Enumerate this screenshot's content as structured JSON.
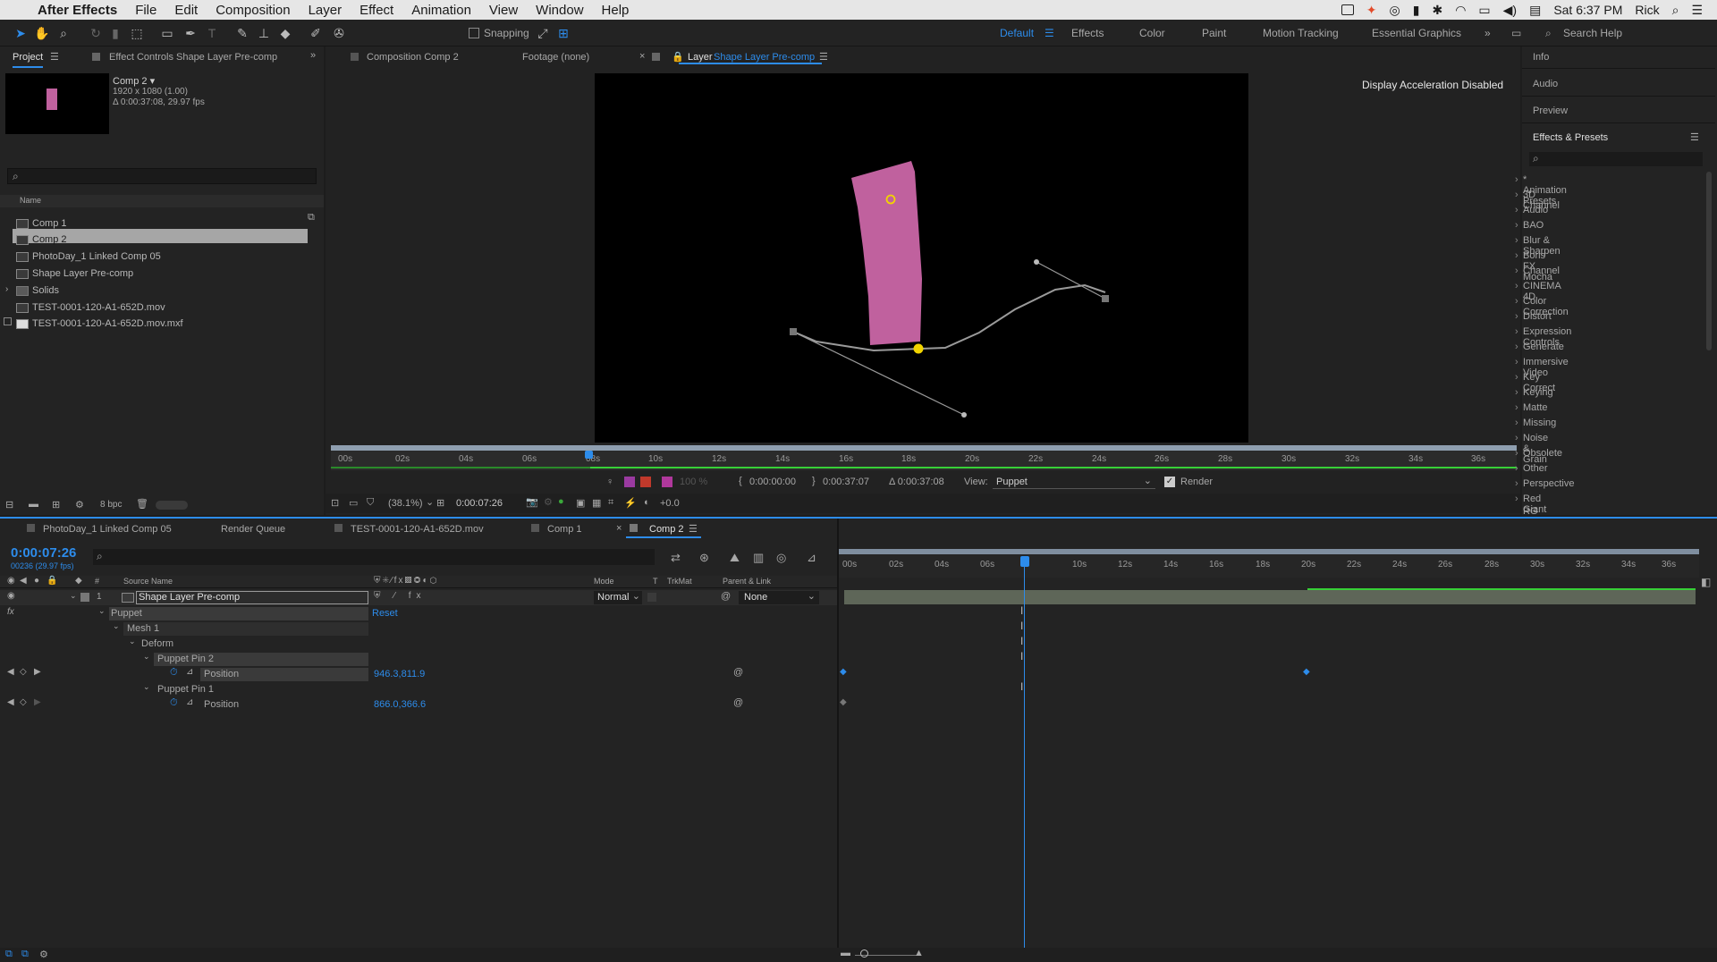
{
  "menubar": {
    "app_name": "After Effects",
    "items": [
      "File",
      "Edit",
      "Composition",
      "Layer",
      "Effect",
      "Animation",
      "View",
      "Window",
      "Help"
    ],
    "clock": "Sat 6:37 PM",
    "user": "Rick"
  },
  "toolbar": {
    "snapping_label": "Snapping",
    "workspaces": [
      "Default",
      "Effects",
      "Color",
      "Paint",
      "Motion Tracking",
      "Essential Graphics"
    ],
    "search_help": "Search Help"
  },
  "project": {
    "tab_label": "Project",
    "effect_controls_tab": "Effect Controls Shape Layer Pre-comp",
    "comp_name": "Comp 2 ▾",
    "comp_size": "1920 x 1080 (1.00)",
    "comp_duration": "Δ 0:00:37:08, 29.97 fps",
    "search_placeholder": "",
    "column_name": "Name",
    "items": [
      "Comp 1",
      "Comp 2",
      "PhotoDay_1 Linked Comp 05",
      "Shape Layer Pre-comp",
      "Solids",
      "TEST-0001-120-A1-652D.mov",
      "TEST-0001-120-A1-652D.mov.mxf"
    ],
    "bpc": "8 bpc"
  },
  "viewer": {
    "tab_composition": "Composition Comp 2",
    "tab_footage": "Footage (none)",
    "tab_layer_prefix": "Layer",
    "tab_layer_name": "Shape Layer Pre-comp",
    "notice": "Display Acceleration Disabled",
    "ruler_labels": [
      "00s",
      "02s",
      "04s",
      "06s",
      "08s",
      "10s",
      "12s",
      "14s",
      "16s",
      "18s",
      "20s",
      "22s",
      "24s",
      "26s",
      "28s",
      "30s",
      "32s",
      "34s",
      "36s"
    ],
    "opacity": "100 %",
    "in_time": "0:00:00:00",
    "out_time": "0:00:37:07",
    "duration": "Δ 0:00:37:08",
    "view_label": "View:",
    "view_value": "Puppet",
    "render_label": "Render",
    "zoom": "(38.1%)",
    "current_time": "0:00:07:26",
    "exposure": "+0.0",
    "shape_color": "#c0619e"
  },
  "right_panels": {
    "info": "Info",
    "audio": "Audio",
    "preview": "Preview",
    "effects_presets": "Effects & Presets",
    "effects": [
      "* Animation Presets",
      "3D Channel",
      "Audio",
      "BAO",
      "Blur & Sharpen",
      "Boris FX Mocha",
      "Channel",
      "CINEMA 4D",
      "Color Correction",
      "Distort",
      "Expression Controls",
      "Generate",
      "Immersive Video",
      "Key Correct",
      "Keying",
      "Matte",
      "Missing",
      "Noise & Grain",
      "Obsolete",
      "Other",
      "Perspective",
      "Red Giant",
      "RG Magic Bullet"
    ]
  },
  "timeline": {
    "tabs": [
      "PhotoDay_1 Linked Comp 05",
      "Render Queue",
      "TEST-0001-120-A1-652D.mov",
      "Comp 1",
      "Comp 2"
    ],
    "timecode": "0:00:07:26",
    "frame_info": "00236 (29.97 fps)",
    "columns": {
      "num": "#",
      "source": "Source Name",
      "mode": "Mode",
      "t": "T",
      "trkmat": "TrkMat",
      "parent": "Parent & Link"
    },
    "layer": {
      "index": "1",
      "name": "Shape Layer Pre-comp",
      "mode": "Normal",
      "parent": "None"
    },
    "props": {
      "puppet": "Puppet",
      "reset": "Reset",
      "mesh": "Mesh 1",
      "deform": "Deform",
      "pin2": "Puppet Pin 2",
      "pin2_prop": "Position",
      "pin2_value": "946.3,811.9",
      "pin1": "Puppet Pin 1",
      "pin1_prop": "Position",
      "pin1_value": "866.0,366.6"
    },
    "ruler_labels": [
      "00s",
      "02s",
      "04s",
      "06s",
      "",
      "10s",
      "12s",
      "14s",
      "16s",
      "18s",
      "20s",
      "22s",
      "24s",
      "26s",
      "28s",
      "30s",
      "32s",
      "34s",
      "36s"
    ]
  }
}
